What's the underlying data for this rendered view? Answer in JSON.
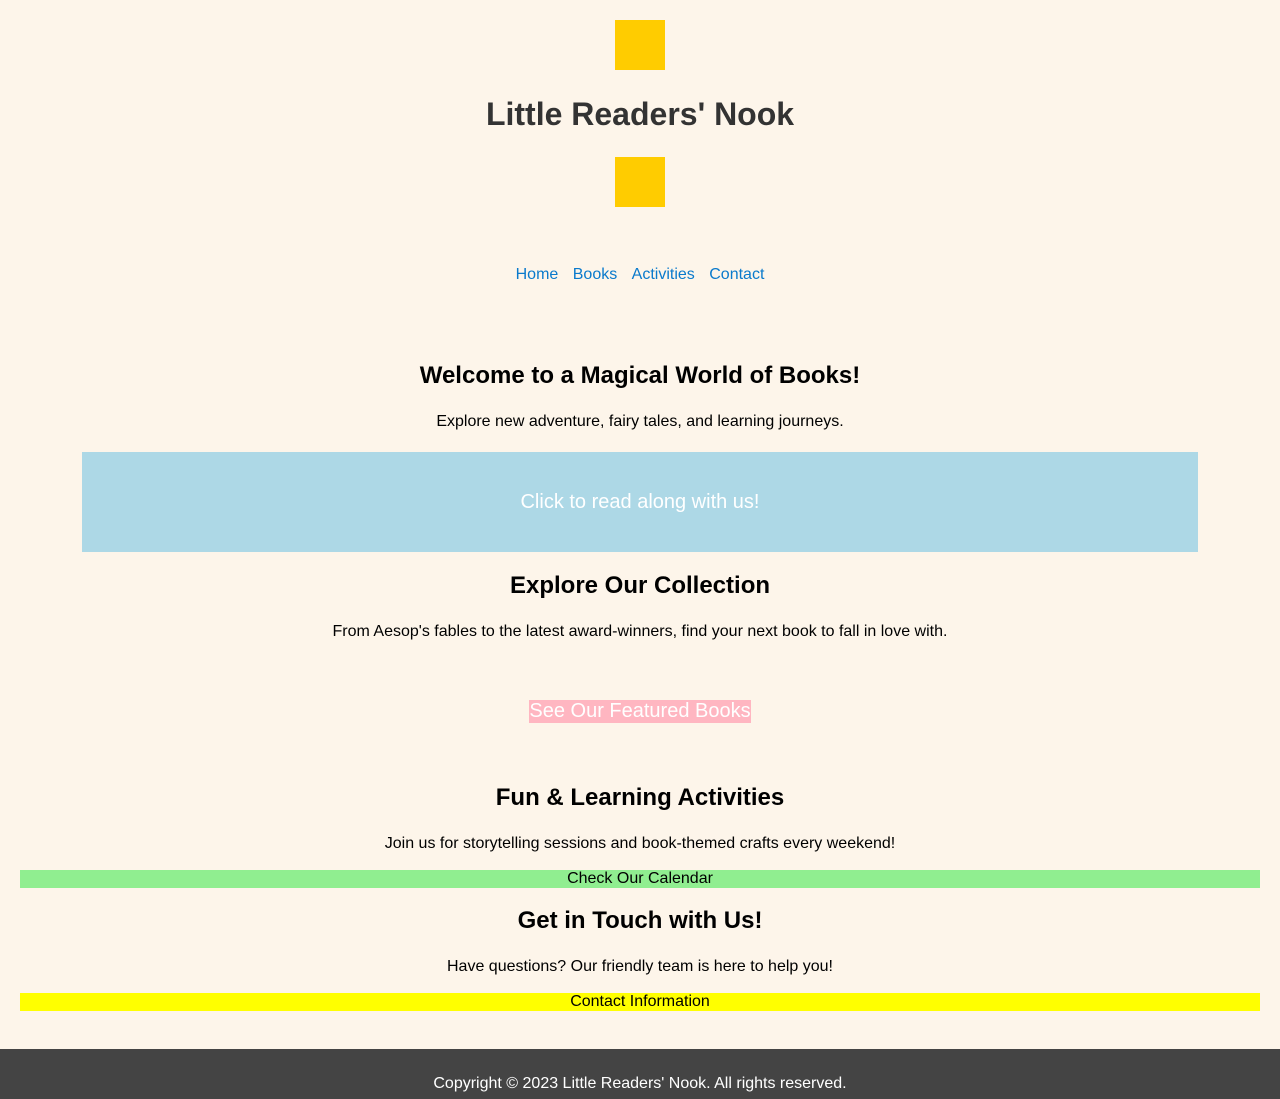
{
  "header": {
    "title": "Little Readers' Nook",
    "accent_color": "#ffcc00"
  },
  "nav": {
    "items": [
      "Home",
      "Books",
      "Activities",
      "Contact"
    ]
  },
  "welcome": {
    "heading": "Welcome to a Magical World of Books!",
    "text": "Explore new adventure, fairy tales, and learning journeys.",
    "cta": "Click to read along with us!"
  },
  "collection": {
    "heading": "Explore Our Collection",
    "text": "From Aesop's fables to the latest award-winners, find your next book to fall in love with.",
    "cta": "See Our Featured Books"
  },
  "activities": {
    "heading": "Fun & Learning Activities",
    "text": "Join us for storytelling sessions and book-themed crafts every weekend!",
    "cta": "Check Our Calendar"
  },
  "contact": {
    "heading": "Get in Touch with Us!",
    "text": "Have questions? Our friendly team is here to help you!",
    "cta": "Contact Information"
  },
  "footer": {
    "copyright": "Copyright © 2023 Little Readers' Nook. All rights reserved."
  }
}
